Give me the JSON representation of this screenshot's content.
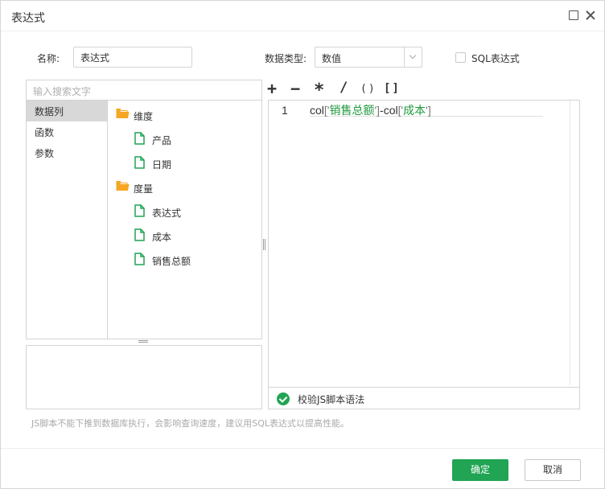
{
  "dialog": {
    "title": "表达式"
  },
  "form": {
    "name_label": "名称:",
    "name_value": "表达式",
    "type_label": "数据类型:",
    "type_value": "数值",
    "sql_label": "SQL表达式",
    "sql_checked": false
  },
  "search": {
    "placeholder": "输入搜索文字"
  },
  "categories": [
    {
      "label": "数据列",
      "active": true
    },
    {
      "label": "函数",
      "active": false
    },
    {
      "label": "参数",
      "active": false
    }
  ],
  "tree": {
    "folders": [
      {
        "label": "维度",
        "icon": "folder-icon",
        "children": [
          "产品",
          "日期"
        ]
      },
      {
        "label": "度量",
        "icon": "folder-icon",
        "children": [
          "表达式",
          "成本",
          "销售总额"
        ]
      }
    ]
  },
  "operators": {
    "plus": "+",
    "minus": "−",
    "multiply": "*",
    "divide": "/",
    "paren": "()",
    "bracket": "[]"
  },
  "editor": {
    "line_number": "1",
    "code": {
      "p1": "col",
      "b1": "['",
      "s1": "销售总额",
      "b2": "']",
      "p2": "-col",
      "b3": "['",
      "s2": "成本",
      "b4": "']"
    },
    "validate_label": "校验JS脚本语法"
  },
  "hint": "JS脚本不能下推到数据库执行，会影响查询速度，建议用SQL表达式以提高性能。",
  "buttons": {
    "ok": "确定",
    "cancel": "取消"
  },
  "colors": {
    "accent": "#21a453",
    "folder": "#f5a623",
    "file": "#21a453"
  }
}
